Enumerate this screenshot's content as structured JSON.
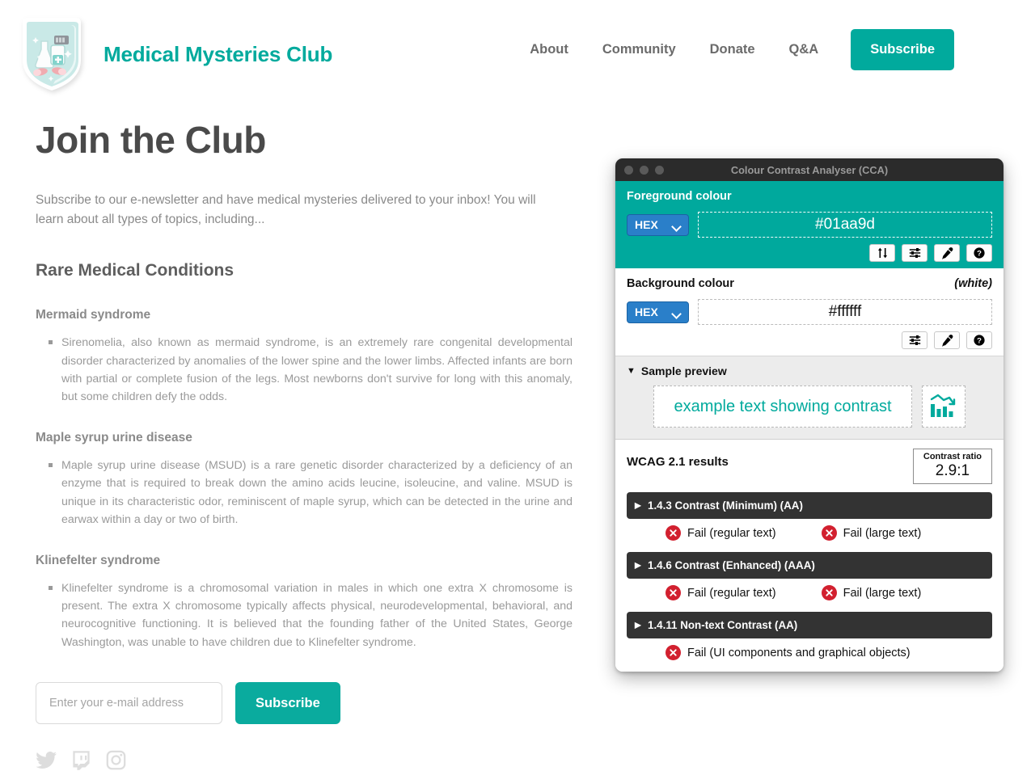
{
  "site": {
    "brand_name": "Medical Mysteries Club",
    "logo_icon": "medical-shield-logo",
    "nav": [
      {
        "label": "About"
      },
      {
        "label": "Community"
      },
      {
        "label": "Donate"
      },
      {
        "label": "Q&A"
      }
    ],
    "nav_subscribe_label": "Subscribe",
    "accent_color": "#01aa9d"
  },
  "main": {
    "page_title": "Join the Club",
    "intro": "Subscribe to our e-newsletter and have medical mysteries delivered to your inbox! You will learn about all types of topics, including...",
    "section_heading": "Rare Medical Conditions",
    "conditions": [
      {
        "title": "Mermaid syndrome",
        "body": "Sirenomelia, also known as mermaid syndrome, is an extremely rare congenital developmental disorder characterized by anomalies of the lower spine and the lower limbs. Affected infants are born with partial or complete fusion of the legs. Most newborns don't survive for long with this anomaly, but some children defy the odds."
      },
      {
        "title": "Maple syrup urine disease",
        "body": "Maple syrup urine disease (MSUD) is a rare genetic disorder characterized by a deficiency of an enzyme that is required to break down the amino acids leucine, isoleucine, and valine. MSUD is unique in its characteristic odor, reminiscent of maple syrup, which can be detected in the urine and earwax within a day or two of birth."
      },
      {
        "title": "Klinefelter syndrome",
        "body": "Klinefelter syndrome is a chromosomal variation in males in which one extra X chromosome is present. The extra X chromosome typically affects physical, neurodevelopmental, behavioral, and neurocognitive functioning. It is believed that the founding father of the United States, George Washington, was unable to have children due to Klinefelter syndrome."
      }
    ],
    "form": {
      "email_placeholder": "Enter your e-mail address",
      "email_value": "",
      "submit_label": "Subscribe"
    },
    "social": [
      {
        "name": "twitter-icon"
      },
      {
        "name": "twitch-icon"
      },
      {
        "name": "instagram-icon"
      }
    ]
  },
  "cca": {
    "window_title": "Colour Contrast Analyser (CCA)",
    "foreground": {
      "label": "Foreground colour",
      "format": "HEX",
      "value": "#01aa9d",
      "buttons": [
        {
          "name": "swap-colours-icon"
        },
        {
          "name": "sliders-icon"
        },
        {
          "name": "eyedropper-icon"
        },
        {
          "name": "help-icon"
        }
      ]
    },
    "background": {
      "label": "Background colour",
      "note": "(white)",
      "format": "HEX",
      "value": "#ffffff",
      "buttons": [
        {
          "name": "sliders-icon"
        },
        {
          "name": "eyedropper-icon"
        },
        {
          "name": "help-icon"
        }
      ]
    },
    "sample": {
      "heading": "Sample preview",
      "disclosure": "▼",
      "text": "example text showing contrast",
      "chart_icon": "bar-chart-down-icon"
    },
    "results": {
      "title": "WCAG 2.1 results",
      "ratio_label": "Contrast ratio",
      "ratio_value": "2.9:1",
      "criteria": [
        {
          "name": "1.4.3 Contrast (Minimum) (AA)",
          "results": [
            {
              "status": "Fail (regular text)"
            },
            {
              "status": "Fail (large text)"
            }
          ]
        },
        {
          "name": "1.4.6 Contrast (Enhanced) (AAA)",
          "results": [
            {
              "status": "Fail (regular text)"
            },
            {
              "status": "Fail (large text)"
            }
          ]
        },
        {
          "name": "1.4.11 Non-text Contrast (AA)",
          "results": [
            {
              "status": "Fail (UI components and graphical objects)"
            }
          ]
        }
      ]
    }
  }
}
